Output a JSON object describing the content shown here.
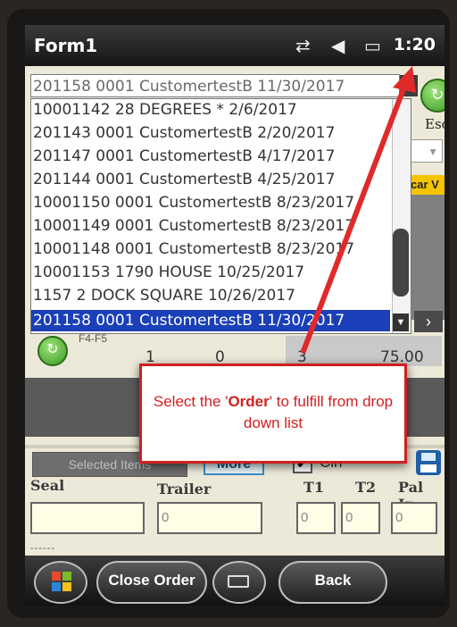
{
  "titlebar": {
    "title": "Form1",
    "time": "1:20",
    "icons": [
      "signal-icon",
      "volume-icon",
      "battery-icon"
    ]
  },
  "order_select": {
    "value": "201158 0001 CustomertestB 11/30/2017",
    "options": [
      "10001142 28 DEGREES * 2/6/2017",
      "201143 0001 CustomertestB 2/20/2017",
      "201147 0001 CustomertestB 4/17/2017",
      "201144 0001 CustomertestB 4/25/2017",
      "10001150 0001 CustomertestB 8/23/2017",
      "10001149 0001 CustomertestB 8/23/2017",
      "10001148 0001 CustomertestB 8/23/2017",
      "10001153 1790 HOUSE 10/25/2017",
      "1157 2 DOCK SQUARE 10/26/2017",
      "201158 0001 CustomertestB 11/30/2017"
    ],
    "selected_index": 9
  },
  "esc_label": "Esc",
  "partial_header": "car V",
  "key_hint": "F4-F5",
  "summary": {
    "v1": "1",
    "v2": "0",
    "v3": "3",
    "v4": "75.00"
  },
  "selected_items_label": "Selected Items",
  "more_label": "More",
  "cln_label": "Cln",
  "cln_checked": true,
  "labels": {
    "seal": "Seal",
    "trailer": "Trailer",
    "t1": "T1",
    "t2": "T2",
    "pal_in": "Pal In"
  },
  "fields": {
    "seal": "",
    "trailer": "0",
    "t1": "0",
    "t2": "0",
    "pal_in": "0"
  },
  "dashes": "------",
  "bottombar": {
    "close_order": "Close Order",
    "back": "Back"
  },
  "annotation": {
    "before": "Select the '",
    "emphasis": "Order",
    "after": "' to fulfill from drop down list"
  },
  "colors": {
    "selection": "#1a3fb8",
    "annotation": "#d12020",
    "accent_green": "#3d9a22",
    "column_header": "#f5c400"
  }
}
